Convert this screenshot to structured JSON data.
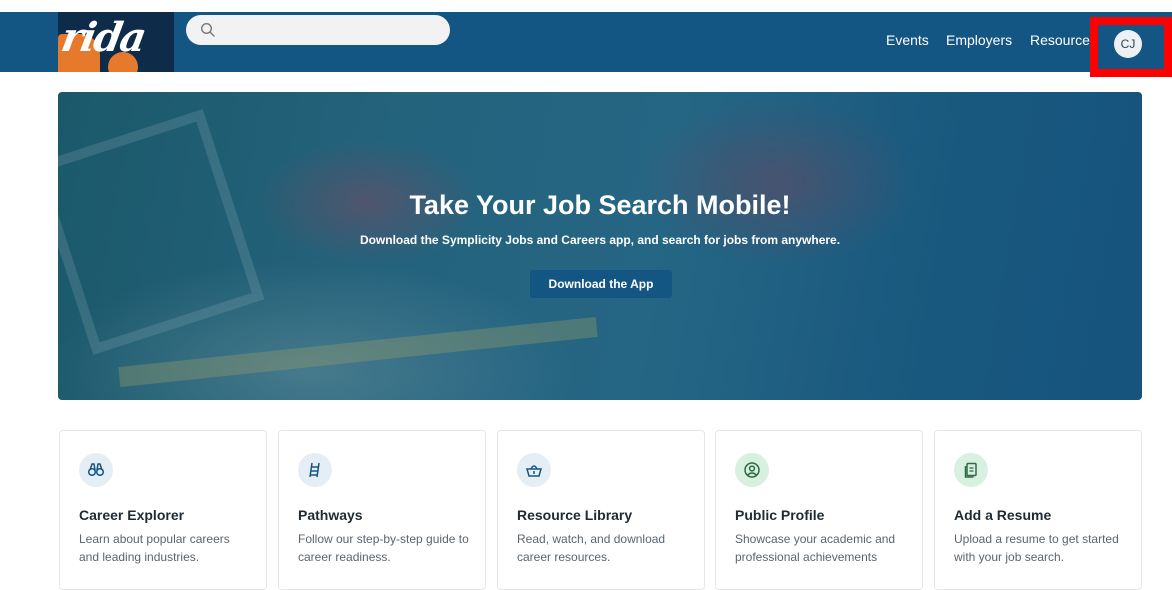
{
  "header": {
    "logo_text": "rida",
    "search_placeholder": "",
    "nav": [
      "Events",
      "Employers",
      "Resources"
    ],
    "avatar_initials": "CJ"
  },
  "hero": {
    "title": "Take Your Job Search Mobile!",
    "subtitle": "Download the Symplicity Jobs and Careers app, and search for jobs from anywhere.",
    "button_label": "Download the App"
  },
  "cards": [
    {
      "title": "Career Explorer",
      "desc": "Learn about popular careers and leading industries.",
      "icon": "binoculars-icon"
    },
    {
      "title": "Pathways",
      "desc": "Follow our step-by-step guide to career readiness.",
      "icon": "ladder-icon"
    },
    {
      "title": "Resource Library",
      "desc": "Read, watch, and download career resources.",
      "icon": "basket-icon"
    },
    {
      "title": "Public Profile",
      "desc": "Showcase your academic and professional achievements",
      "icon": "profile-icon"
    },
    {
      "title": "Add a Resume",
      "desc": "Upload a resume to get started with your job search.",
      "icon": "document-icon"
    }
  ],
  "colors": {
    "navbar": "#135684",
    "highlight": "#ff0000",
    "accent_blue": "#135684",
    "accent_green": "#2e8b57"
  }
}
